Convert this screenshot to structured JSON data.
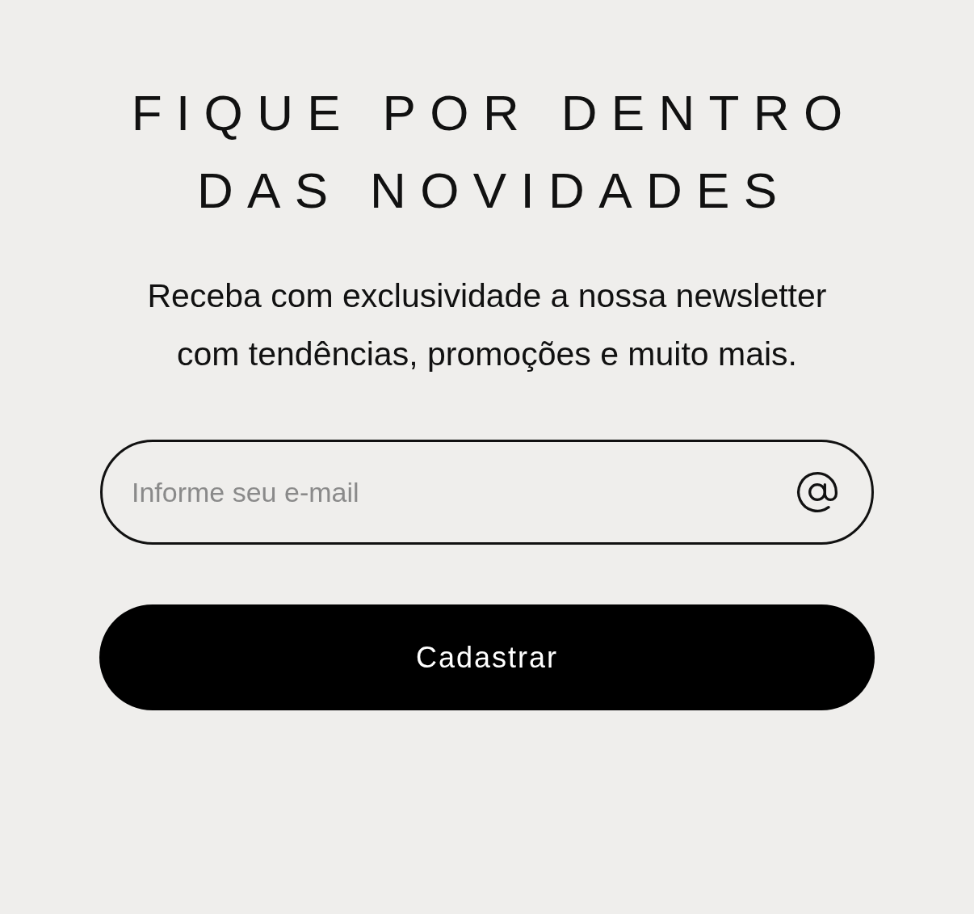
{
  "title_lines": [
    "FIQUE POR DENTRO",
    "DAS NOVIDADES"
  ],
  "description": "Receba com exclusividade a nossa newsletter com tendências, promoções e muito mais.",
  "email_field": {
    "placeholder": "Informe seu e-mail"
  },
  "submit_button": {
    "label": "Cadastrar"
  }
}
